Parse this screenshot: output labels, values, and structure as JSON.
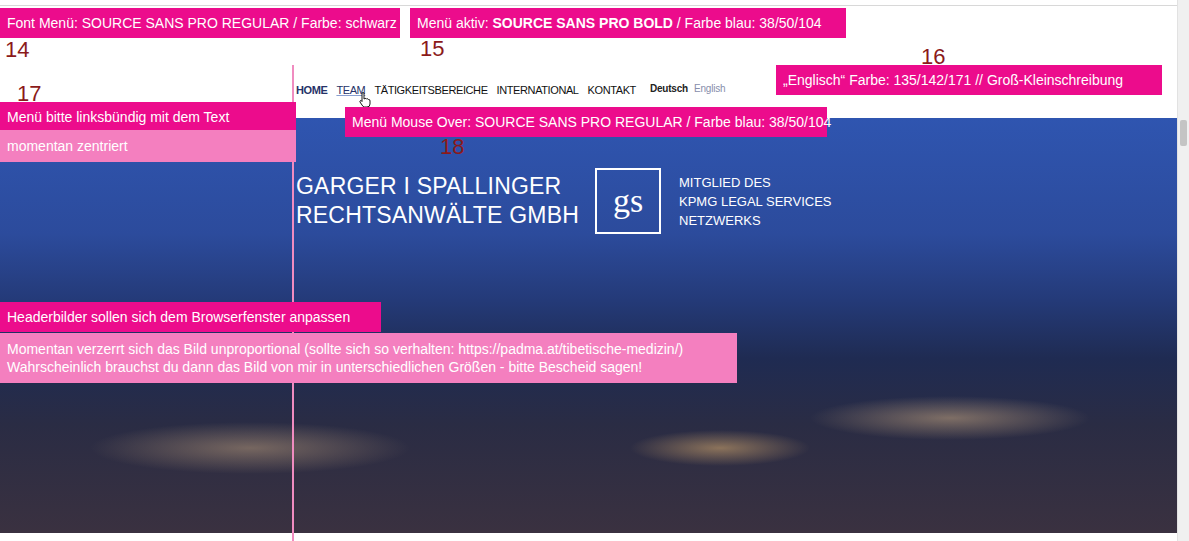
{
  "nav": {
    "items": [
      {
        "label": "HOME",
        "selected": true,
        "hover": false
      },
      {
        "label": "TEAM",
        "selected": false,
        "hover": true
      },
      {
        "label": "TÄTIGKEITSBEREICHE",
        "selected": false,
        "hover": false
      },
      {
        "label": "INTERNATIONAL",
        "selected": false,
        "hover": false
      },
      {
        "label": "KONTAKT",
        "selected": false,
        "hover": false
      }
    ]
  },
  "languages": [
    {
      "label": "Deutsch",
      "selected": true
    },
    {
      "label": "English",
      "selected": false
    }
  ],
  "logo": {
    "name_lines": [
      "GARGER I SPALLINGER",
      "RECHTSANWÄLTE GMBH"
    ],
    "monogram": "gs",
    "member_lines": [
      "MITGLIED DES",
      "KPMG LEGAL SERVICES",
      "NETZWERKS"
    ]
  },
  "annotations": [
    {
      "number": "14",
      "parts": [
        {
          "text": "Font Menü:  SOURCE SANS PRO REGULAR / Farbe: schwarz",
          "bold": false
        }
      ],
      "note": []
    },
    {
      "number": "15",
      "parts": [
        {
          "text": "Menü aktiv:  ",
          "bold": false
        },
        {
          "text": "SOURCE SANS PRO BOLD",
          "bold": true
        },
        {
          "text": " / Farbe blau: 38/50/104",
          "bold": false
        }
      ],
      "note": []
    },
    {
      "number": "16",
      "parts": [
        {
          "text": "„Englisch“ Farbe: 135/142/171 // Groß-Kleinschreibung",
          "bold": false
        }
      ],
      "note": []
    },
    {
      "number": "17",
      "parts": [
        {
          "text": "Menü bitte linksbündig mit dem Text",
          "bold": false
        }
      ],
      "note": [
        "momentan zentriert"
      ]
    },
    {
      "number": "18",
      "parts": [
        {
          "text": "Menü Mouse Over:  SOURCE SANS PRO REGULAR / Farbe blau: 38/50/104",
          "bold": false
        }
      ],
      "note": []
    },
    {
      "number": "",
      "parts": [
        {
          "text": "Headerbilder sollen sich dem Browserfenster anpassen",
          "bold": false
        }
      ],
      "note": [
        "Momentan verzerrt sich das Bild unproportional (sollte sich so verhalten: https://padma.at/tibetische-medizin/)",
        "Wahrscheinlich brauchst du dann das Bild von mir in unterschiedlichen Größen - bitte Bescheid sagen!"
      ]
    }
  ]
}
